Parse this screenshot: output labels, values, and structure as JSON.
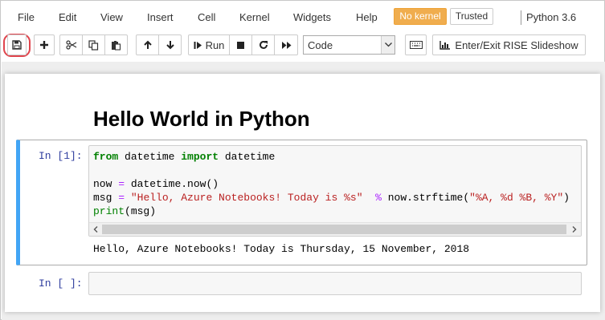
{
  "menu": {
    "items": [
      "File",
      "Edit",
      "View",
      "Insert",
      "Cell",
      "Kernel",
      "Widgets",
      "Help"
    ],
    "kernel_status": "No kernel",
    "trusted": "Trusted",
    "kernel_name": "Python 3.6"
  },
  "toolbar": {
    "run_label": "Run",
    "cell_type": "Code",
    "rise_label": "Enter/Exit RISE Slideshow",
    "icons": [
      "save-icon",
      "plus-icon",
      "cut-icon",
      "copy-icon",
      "paste-icon",
      "arrow-up-icon",
      "arrow-down-icon",
      "step-forward-icon",
      "stop-icon",
      "restart-icon",
      "fast-forward-icon",
      "keyboard-icon",
      "bar-chart-icon"
    ]
  },
  "notebook": {
    "heading": "Hello World in Python",
    "cells": [
      {
        "prompt": "In [1]:",
        "code": {
          "line1": {
            "kw1": "from",
            "mod": " datetime ",
            "kw2": "import",
            "name": " datetime"
          },
          "line3": {
            "lhs": "now ",
            "op": "=",
            "rhs": " datetime.now()"
          },
          "line4": {
            "lhs": "msg ",
            "op1": "=",
            "sp": " ",
            "str1": "\"Hello, Azure Notebooks! Today is %s\"",
            "sp2": "  ",
            "op2": "%",
            "mid": " now.strftime(",
            "str2": "\"%A, %d %B, %Y\"",
            "end": ")"
          },
          "line5": {
            "fn": "print",
            "args": "(msg)"
          }
        },
        "output": "Hello, Azure Notebooks! Today is Thursday, 15 November, 2018"
      },
      {
        "prompt": "In [ ]:",
        "code": ""
      }
    ]
  },
  "colors": {
    "selected_cell_border": "#42a5f5",
    "kernel_badge": "#f0ad4e",
    "save_highlight": "#e0454d",
    "keyword": "#008000",
    "string": "#ba2121",
    "operator": "#aa22ff",
    "prompt": "#303f9f"
  }
}
